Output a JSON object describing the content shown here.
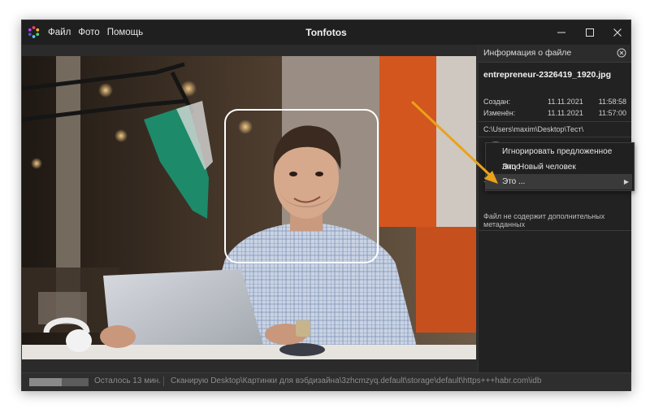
{
  "window": {
    "title": "Tonfotos",
    "menu": [
      "Файл",
      "Фото",
      "Помощь"
    ]
  },
  "panel": {
    "header": "Информация о файле",
    "filename": "entrepreneur-2326419_1920.jpg",
    "created_label": "Создан:",
    "created_date": "11.11.2021",
    "created_time": "11:58:58",
    "modified_label": "Изменён:",
    "modified_date": "11.11.2021",
    "modified_time": "11:57:00",
    "path": "C:\\Users\\maxim\\Desktop\\Тест\\",
    "face_label_visible": "1",
    "metadata_note": "Файл не содержит дополнительных метаданных"
  },
  "context_menu": {
    "items": [
      "Игнорировать предложенное лицо",
      "Это Новый человек",
      "Это ..."
    ],
    "highlighted_index": 2
  },
  "status": {
    "progress_fraction": 0.55,
    "remaining": "Осталось 13 мин.",
    "scanning": "Сканирую Desktop\\Картинки для вэбдизайна\\3zhcmzyq.default\\storage\\default\\https+++habr.com\\idb"
  },
  "colors": {
    "window_bg": "#2b2b2b",
    "titlebar_bg": "#1f1f1f",
    "panel_bg": "#222222",
    "annotation_arrow": "#e9a21b",
    "face_badge": "#d93a2b"
  },
  "icons": {
    "app_logo": "tonfotos-logo-icon",
    "minimize": "minimize-icon",
    "maximize": "maximize-icon",
    "close": "close-icon",
    "panel_close": "circle-close-icon",
    "submenu": "chevron-right-icon"
  }
}
